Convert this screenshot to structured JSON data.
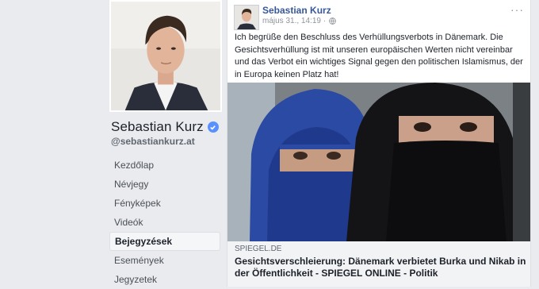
{
  "page": {
    "name": "Sebastian Kurz",
    "handle": "@sebastiankurz.at"
  },
  "nav": {
    "items": [
      {
        "label": "Kezdőlap"
      },
      {
        "label": "Névjegy"
      },
      {
        "label": "Fényképek"
      },
      {
        "label": "Videók"
      },
      {
        "label": "Bejegyzések"
      },
      {
        "label": "Események"
      },
      {
        "label": "Jegyzetek"
      }
    ],
    "active_index": 4
  },
  "post": {
    "author": "Sebastian Kurz",
    "timestamp": "május 31., 14:19 ·",
    "options_label": "···",
    "text": "Ich begrüße den Beschluss des Verhüllungsverbots in Dänemark. Die Gesichtsverhüllung ist mit unseren europäischen Werten nicht vereinbar und das Verbot ein wichtiges Signal gegen den politischen Islamismus, der in Europa keinen Platz hat!",
    "link": {
      "domain": "SPIEGEL.DE",
      "title": "Gesichtsverschleierung: Dänemark verbietet Burka und Nikab in der Öffentlichkeit - SPIEGEL ONLINE - Politik"
    }
  },
  "colors": {
    "link_blue": "#365899",
    "verified_blue": "#5890ff",
    "background": "#e9ebee"
  }
}
